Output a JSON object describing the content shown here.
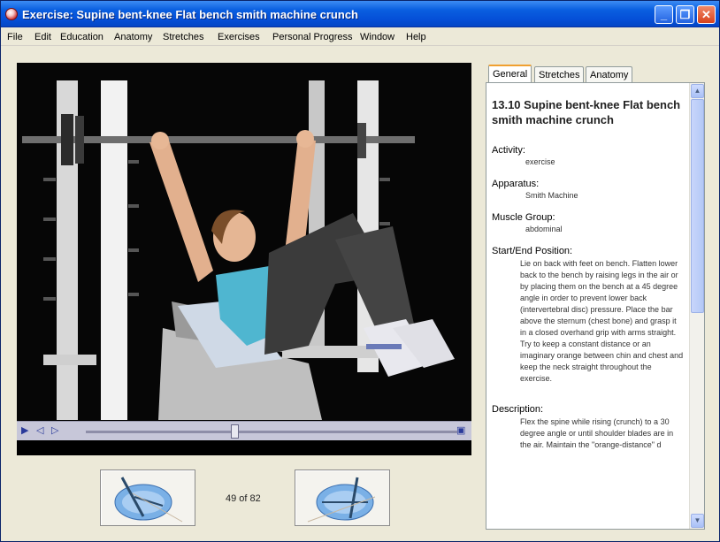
{
  "window": {
    "title": "Exercise: Supine bent-knee Flat bench smith machine crunch",
    "minimize_label": "_",
    "maximize_label": "❐",
    "close_label": "✕"
  },
  "menu": [
    "File",
    "Edit",
    "Education",
    "Anatomy",
    "Stretches",
    "Exercises",
    "Personal Progress",
    "Window",
    "Help"
  ],
  "player": {
    "play_label": "▶",
    "prev_label": "◁",
    "next_label": "▷",
    "end_label": "▣",
    "progress": 0.4
  },
  "navigation": {
    "counter": "49 of 82"
  },
  "tabs": [
    "General",
    "Stretches",
    "Anatomy"
  ],
  "active_tab": "General",
  "info": {
    "title": "13.10 Supine bent-knee Flat bench smith machine crunch",
    "activity_label": "Activity:",
    "activity_value": "exercise",
    "apparatus_label": "Apparatus:",
    "apparatus_value": "Smith Machine",
    "muscle_group_label": "Muscle Group:",
    "muscle_group_value": "abdominal",
    "position_label": "Start/End Position:",
    "position_text": "Lie on back with feet on bench. Flatten lower back to the bench by raising legs in the air or by placing them on the bench at a 45 degree angle in order to prevent lower back (intervertebral disc) pressure. Place the bar above the sternum (chest bone) and grasp it in a closed overhand grip with arms straight. Try to keep a constant distance or an imaginary orange between chin and chest and keep the neck straight throughout the exercise.",
    "description_label": "Description:",
    "description_text": "Flex the spine while rising (crunch) to a 30 degree angle or until shoulder blades are in the air. Maintain the \"orange-distance\" d"
  },
  "colors": {
    "titlebar": "#0550d8",
    "window_bg": "#ece9d8",
    "tab_accent": "#f0a030",
    "player_bar": "#c7c7d9"
  }
}
